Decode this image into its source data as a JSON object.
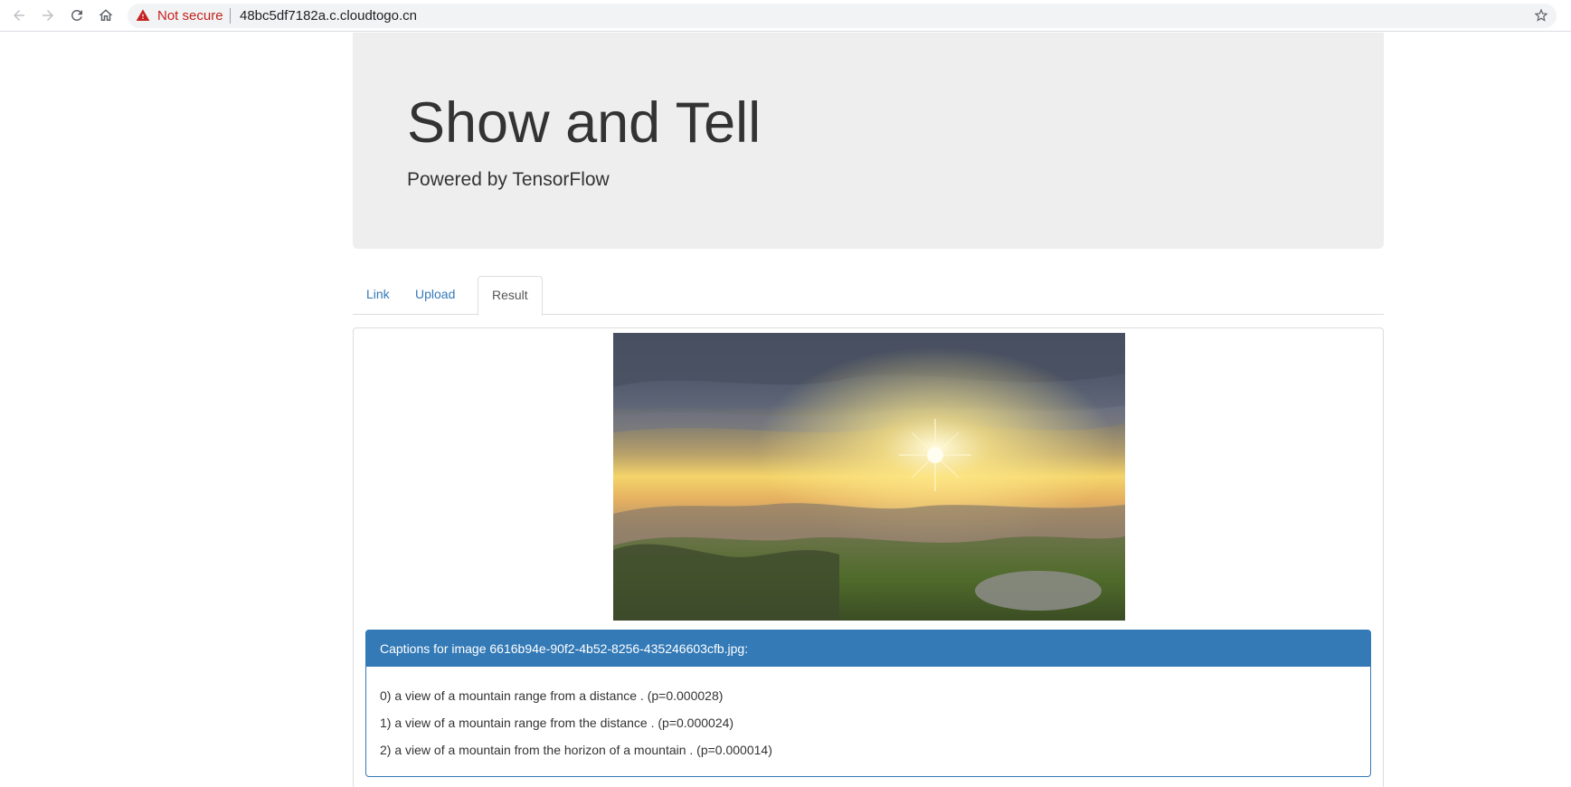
{
  "browser": {
    "security_label": "Not secure",
    "url": "48bc5df7182a.c.cloudtogo.cn",
    "icons": [
      "back-icon",
      "forward-icon",
      "reload-icon",
      "home-icon",
      "warning-icon",
      "star-icon"
    ]
  },
  "header": {
    "title": "Show and Tell",
    "subtitle": "Powered by TensorFlow"
  },
  "tabs": [
    {
      "label": "Link",
      "active": false
    },
    {
      "label": "Upload",
      "active": false
    },
    {
      "label": "Result",
      "active": true
    }
  ],
  "result": {
    "captions_heading": "Captions for image 6616b94e-90f2-4b52-8256-435246603cfb.jpg:",
    "captions": [
      "0) a view of a mountain range from a distance . (p=0.000028)",
      "1) a view of a mountain range from the distance . (p=0.000024)",
      "2) a view of a mountain from the horizon of a mountain . (p=0.000014)"
    ]
  },
  "colors": {
    "primary": "#337ab7",
    "jumbotron_bg": "#eeeeee",
    "warning_red": "#c5221f"
  }
}
